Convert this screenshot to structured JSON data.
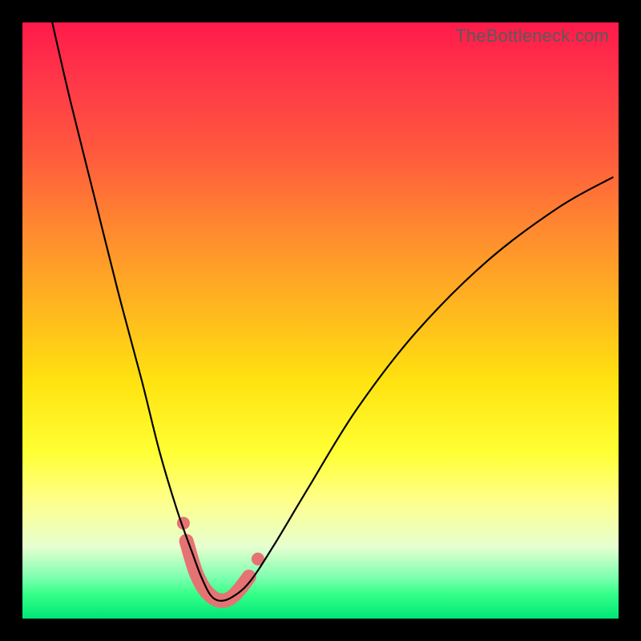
{
  "watermark": "TheBottleneck.com",
  "chart_data": {
    "type": "line",
    "title": "",
    "xlabel": "",
    "ylabel": "",
    "xlim": [
      0,
      100
    ],
    "ylim": [
      0,
      100
    ],
    "grid": false,
    "series": [
      {
        "name": "bottleneck-curve",
        "x": [
          5,
          8,
          12,
          16,
          20,
          23,
          26,
          28.5,
          30,
          31.5,
          33,
          35,
          38,
          42,
          48,
          56,
          66,
          78,
          90,
          99
        ],
        "y": [
          100,
          87,
          71,
          55,
          40,
          28,
          18,
          11,
          7,
          4,
          3,
          3.5,
          6,
          12,
          22,
          35,
          48,
          60,
          69,
          74
        ]
      }
    ],
    "highlight": {
      "name": "optimal-range",
      "x": [
        27.5,
        29,
        30.5,
        32,
        33.5,
        35,
        36.5,
        38
      ],
      "y": [
        13,
        8,
        5,
        3.5,
        3,
        3.5,
        5,
        7
      ]
    },
    "highlight_ends": [
      {
        "x": 27,
        "y": 16
      },
      {
        "x": 39.5,
        "y": 10
      }
    ],
    "colors": {
      "curve": "#000000",
      "trough": "#e57373",
      "gradient_top": "#ff1a4b",
      "gradient_bottom": "#00e676"
    }
  }
}
